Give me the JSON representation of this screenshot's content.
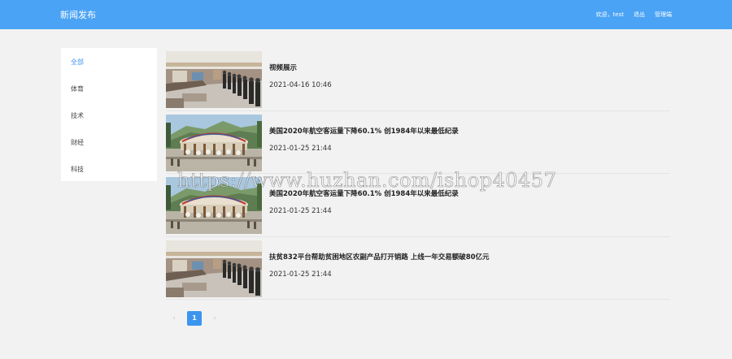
{
  "header": {
    "brand": "新闻发布",
    "nav": [
      {
        "label": "欢迎，test"
      },
      {
        "label": "退出"
      },
      {
        "label": "管理端"
      }
    ]
  },
  "sidebar": {
    "items": [
      {
        "label": "全部",
        "active": true
      },
      {
        "label": "体育"
      },
      {
        "label": "技术"
      },
      {
        "label": "财经"
      },
      {
        "label": "科技"
      }
    ]
  },
  "news": {
    "items": [
      {
        "title": "视频展示",
        "date": "2021-04-16 10:46",
        "image": "mall-interior"
      },
      {
        "title": "美国2020年航空客运量下降60.1% 创1984年以来最低纪录",
        "date": "2021-01-25 21:44",
        "image": "amusement-park"
      },
      {
        "title": "美国2020年航空客运量下降60.1% 创1984年以来最低纪录",
        "date": "2021-01-25 21:44",
        "image": "amusement-park"
      },
      {
        "title": "扶贫832平台帮助贫困地区农副产品打开销路 上线一年交易额破80亿元",
        "date": "2021-01-25 21:44",
        "image": "mall-interior"
      }
    ]
  },
  "pagination": {
    "prev": "‹",
    "current": "1",
    "next": "›"
  },
  "watermark": "https://www.huzhan.com/ishop40457",
  "colors": {
    "header_bg": "#4aa3f5",
    "accent": "#3b95ef",
    "page_bg": "#f2f2f2"
  }
}
